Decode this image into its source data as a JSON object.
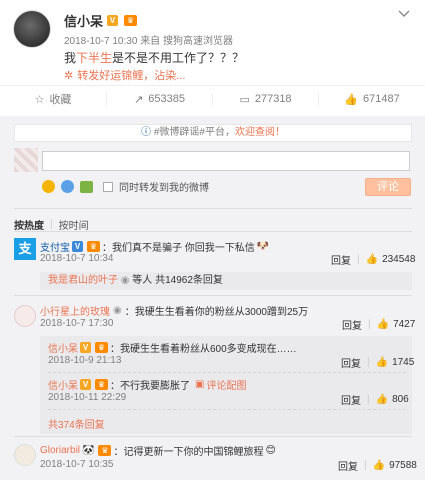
{
  "post": {
    "author": "信小呆",
    "timestamp": "2018-10-7 10:30",
    "source": "来自 搜狗高速浏览器",
    "text_before": "我",
    "text_highlight": "下半生",
    "text_after": "是不是不用工作了？？？",
    "lucky_link": "转发好运锦鲤，沾染..."
  },
  "actions": {
    "favorite": "收藏",
    "repost_count": "653385",
    "comment_count": "277318",
    "like_count": "671487"
  },
  "comment_area": {
    "notice_prefix": "#微博辟谣#平台，",
    "notice_link": "欢迎查阅！",
    "also_repost_label": "同时转发到我的微博",
    "submit_label": "评论"
  },
  "sort": {
    "by_hot": "按热度",
    "by_time": "按时间"
  },
  "comments": [
    {
      "author": "支付宝",
      "text": "：我们真不是骗子 你回我一下私信",
      "time": "2018-10-7 10:34",
      "reply_label": "回复",
      "likes": "234548",
      "subs": [
        {
          "author": "我是君山的叶子",
          "text": "等人 共14962条回复"
        }
      ]
    },
    {
      "author": "小行星上的玫瑰",
      "text": "：我硬生生看着你的粉丝从3000蹭到25万",
      "time": "2018-10-7 17:30",
      "reply_label": "回复",
      "likes": "7427",
      "subs": [
        {
          "author": "信小呆",
          "text": "：我硬生生看着粉丝从600多变成现在……",
          "time": "2018-10-9 21:13",
          "reply_label": "回复",
          "likes": "1745"
        },
        {
          "author": "信小呆",
          "text": "：不行我要膨胀了",
          "pic": "评论配图",
          "time": "2018-10-11 22:29",
          "reply_label": "回复",
          "likes": "806"
        }
      ],
      "more_replies": "共374条回复"
    },
    {
      "author": "Gloriarbil",
      "text": "：记得更新一下你的中国锦鲤旅程",
      "time": "2018-10-7 10:35",
      "reply_label": "回复",
      "likes": "97588"
    }
  ]
}
